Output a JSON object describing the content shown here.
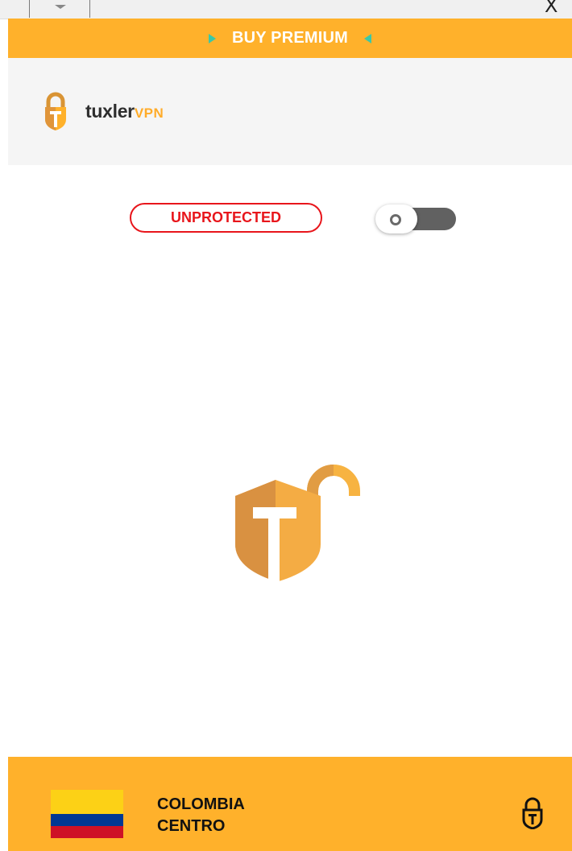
{
  "window": {
    "close_glyph": "X",
    "menu_icon": "chevron-down-icon"
  },
  "banner": {
    "label": "BUY PREMIUM",
    "arrow_color": "#3ac8a8",
    "background": "#ffb12b"
  },
  "brand": {
    "name_main": "tuxler",
    "name_suffix": "VPN",
    "accent": "#ffac2a",
    "icon": "lock-shield-icon"
  },
  "status": {
    "label": "UNPROTECTED",
    "color": "#e8151b",
    "connected": false
  },
  "center": {
    "icon": "unlocked-shield-icon"
  },
  "location": {
    "country": "COLOMBIA",
    "region": "CENTRO",
    "flag": "colombia-flag-icon",
    "action_icon": "lock-icon"
  }
}
